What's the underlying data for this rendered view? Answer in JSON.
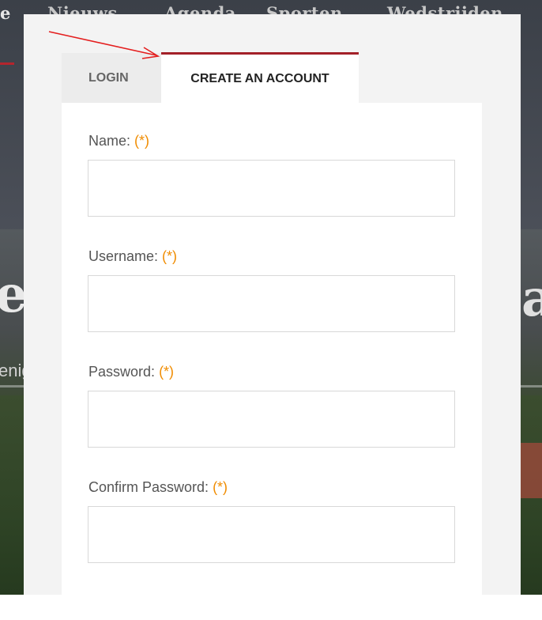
{
  "background": {
    "nav": [
      "e",
      "Nieuws",
      "Agenda",
      "Sporten",
      "Wedstrijden"
    ],
    "hero_title_fragment": "en",
    "hero_subtitle_fragment": "eniging",
    "hero_right_fragment": "a"
  },
  "tabs": {
    "login": "LOGIN",
    "create_account": "CREATE AN ACCOUNT"
  },
  "form": {
    "required_marker": "(*)",
    "fields": [
      {
        "label": "Name:",
        "value": ""
      },
      {
        "label": "Username:",
        "value": ""
      },
      {
        "label": "Password:",
        "value": ""
      },
      {
        "label": "Confirm Password:",
        "value": ""
      }
    ]
  },
  "colors": {
    "accent": "#a32028",
    "required": "#f08c00",
    "arrow": "#e41e1e"
  }
}
